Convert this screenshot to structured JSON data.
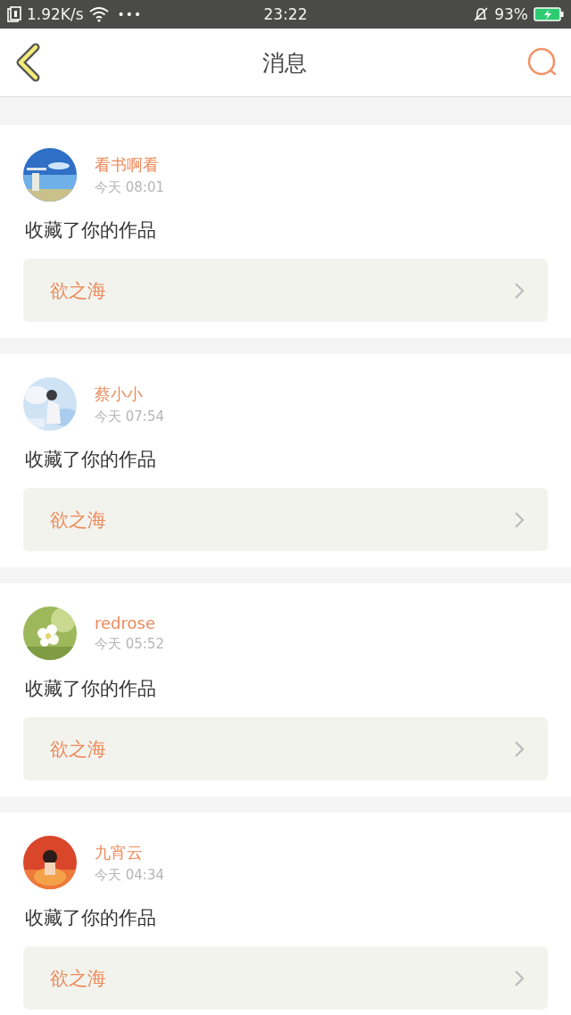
{
  "status_bar": {
    "speed": "1.92K/s",
    "more": "•••",
    "time": "23:22",
    "battery": "93%"
  },
  "header": {
    "title": "消息"
  },
  "messages": [
    {
      "user": "看书啊看",
      "time": "今天 08:01",
      "action": "收藏了你的作品",
      "work": "欲之海"
    },
    {
      "user": "蔡小小",
      "time": "今天 07:54",
      "action": "收藏了你的作品",
      "work": "欲之海"
    },
    {
      "user": "redrose",
      "time": "今天 05:52",
      "action": "收藏了你的作品",
      "work": "欲之海"
    },
    {
      "user": "九宵云",
      "time": "今天 04:34",
      "action": "收藏了你的作品",
      "work": "欲之海"
    }
  ]
}
